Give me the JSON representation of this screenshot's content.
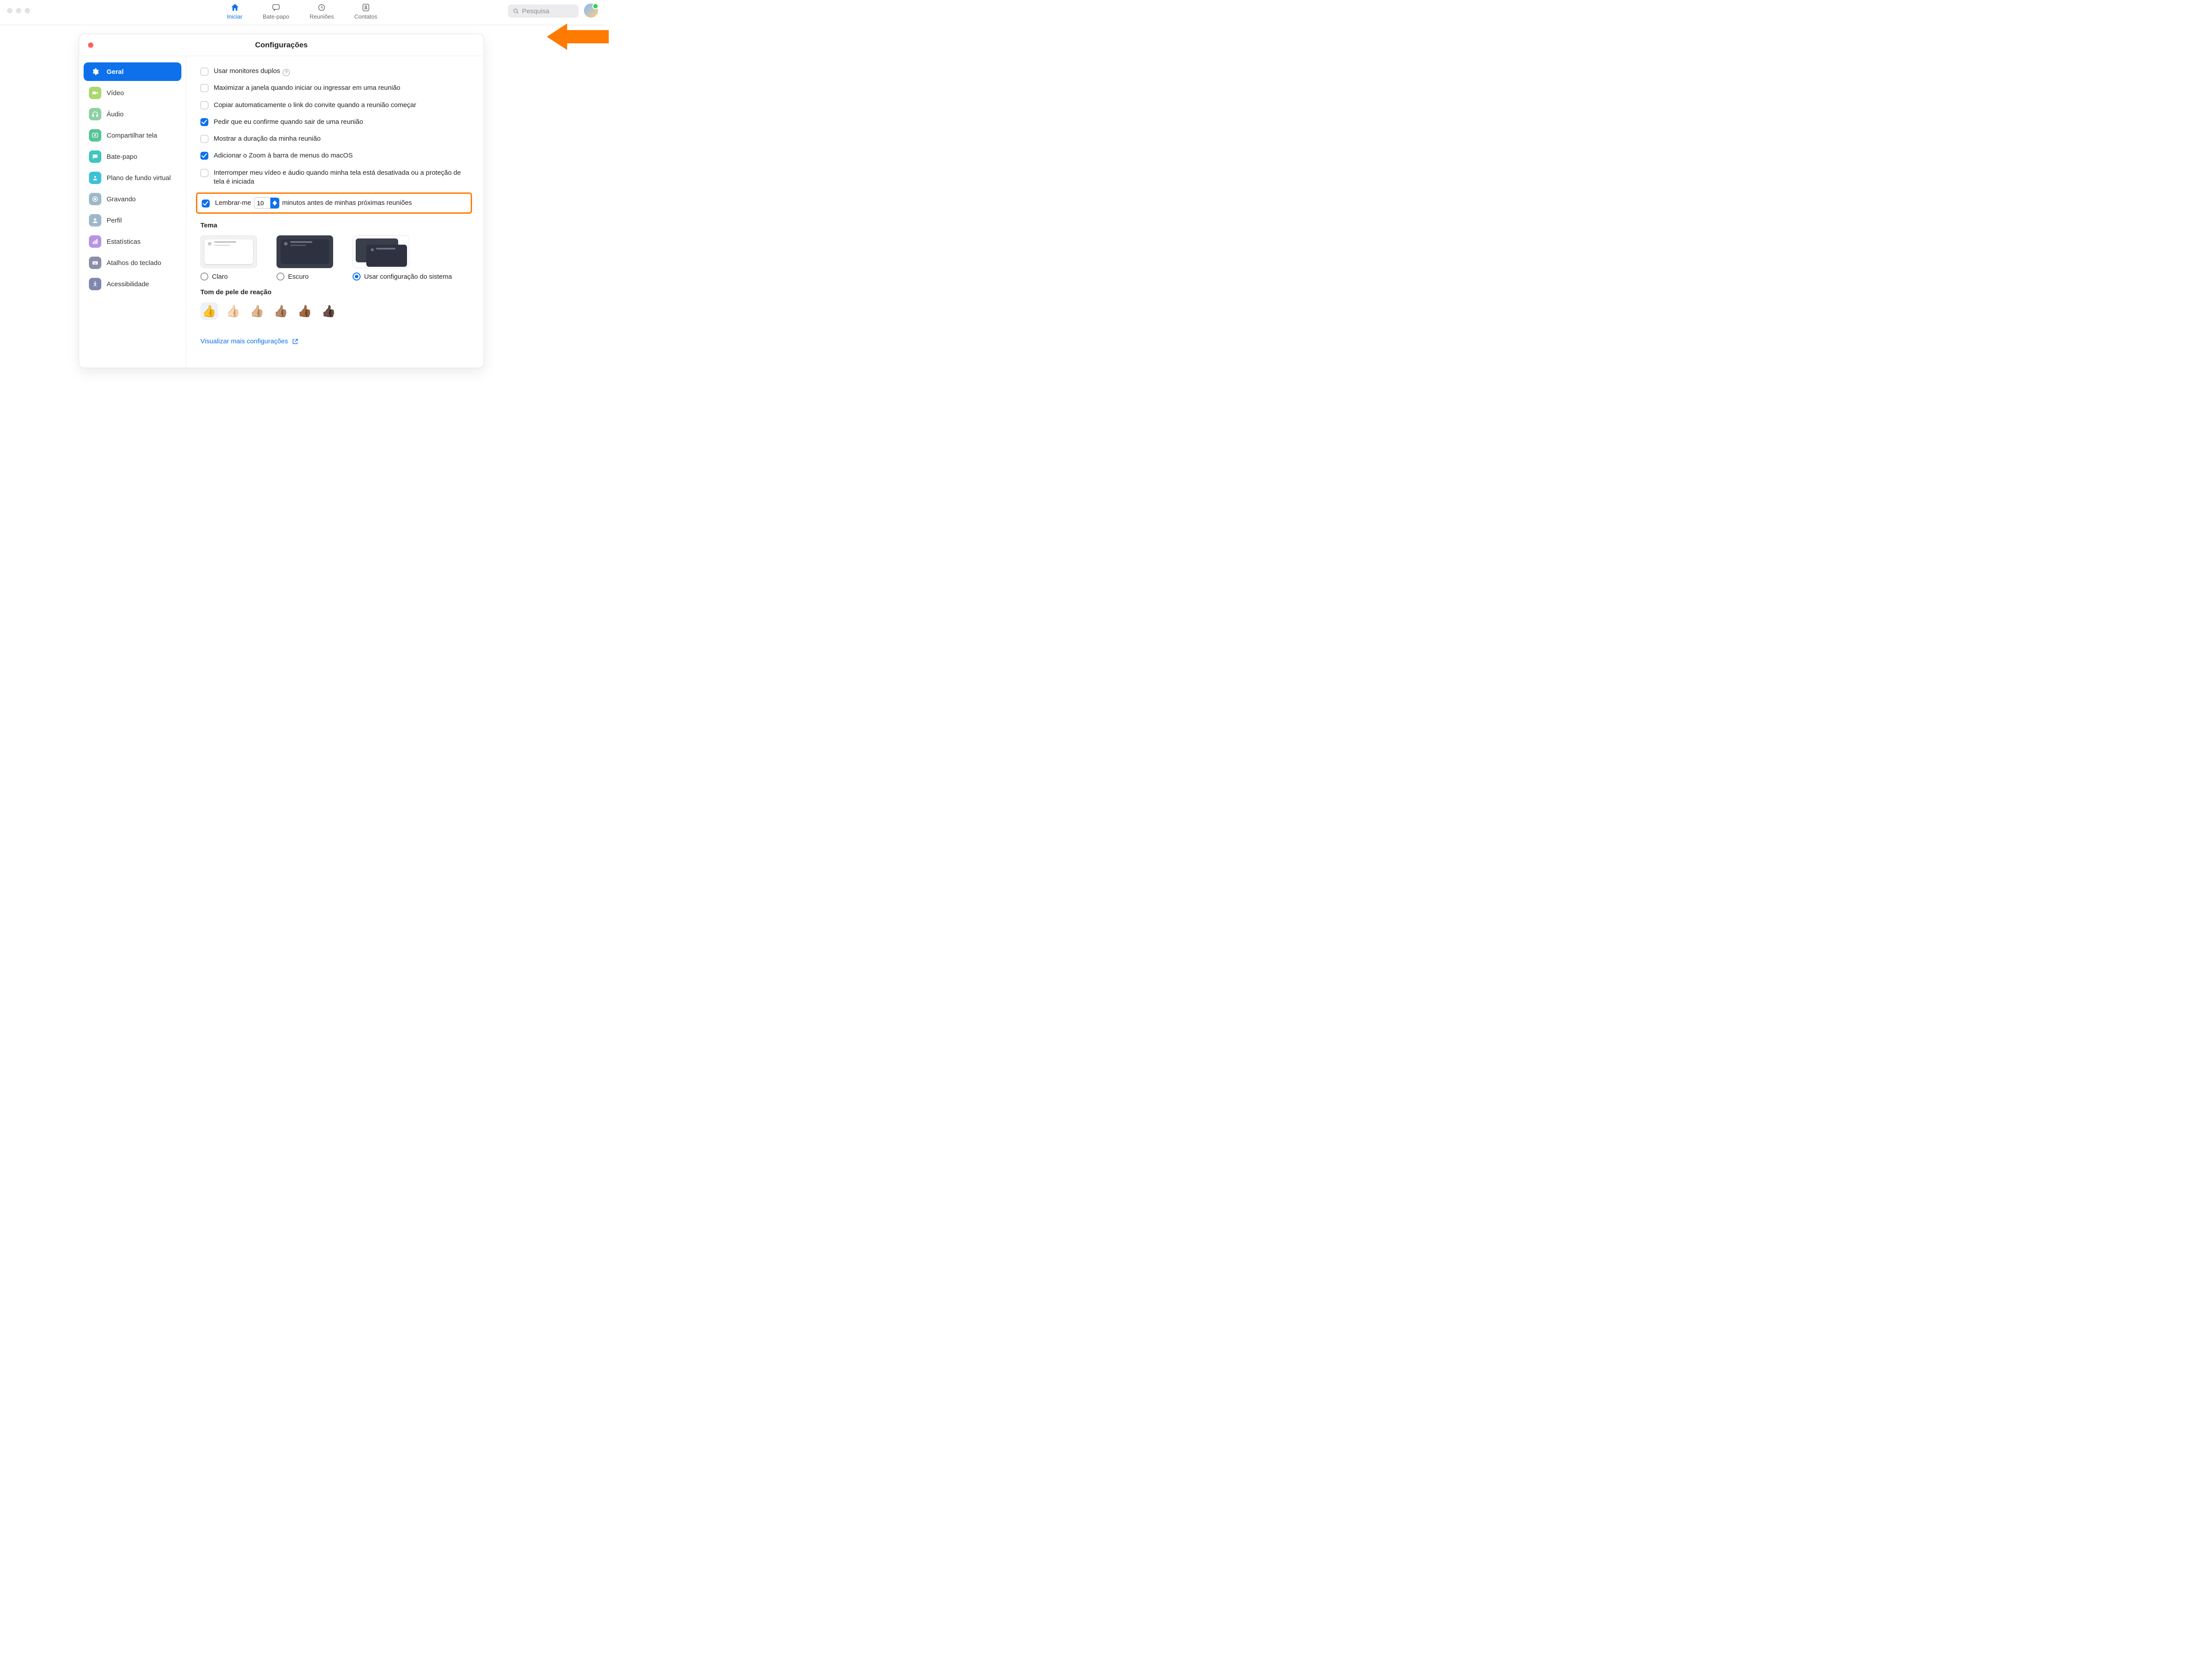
{
  "topnav": {
    "home": "Iniciar",
    "chat": "Bate-papo",
    "meetings": "Reuniões",
    "contacts": "Contatos"
  },
  "search_placeholder": "Pesquisa",
  "window_title": "Configurações",
  "sidebar": {
    "general": "Geral",
    "video": "Vídeo",
    "audio": "Áudio",
    "share": "Compartilhar tela",
    "chat": "Bate-papo",
    "vb": "Plano de fundo virtual",
    "recording": "Gravando",
    "profile": "Perfil",
    "stats": "Estatísticas",
    "shortcuts": "Atalhos do teclado",
    "a11y": "Acessibilidade"
  },
  "opts": {
    "dual": "Usar monitores duplos",
    "maximize": "Maximizar a janela quando iniciar ou ingressar em uma reunião",
    "copy": "Copiar automaticamente o link do convite quando a reunião começar",
    "confirm": "Pedir que eu confirme quando sair de uma reunião",
    "duration": "Mostrar a duração da minha reunião",
    "menubar": "Adicionar o Zoom à barra de menus do macOS",
    "interrupt": "Interromper meu vídeo e áudio quando minha tela está desativada ou a proteção de tela é iniciada",
    "remind_pre": "Lembrar-me",
    "remind_value": "10",
    "remind_post": "minutos antes de minhas próximas reuniões"
  },
  "theme": {
    "title": "Tema",
    "light": "Claro",
    "dark": "Escuro",
    "system": "Usar configuração do sistema"
  },
  "skin_title": "Tom de pele de reação",
  "skins": [
    "👍",
    "👍🏻",
    "👍🏼",
    "👍🏽",
    "👍🏾",
    "👍🏿"
  ],
  "more_link": "Visualizar mais configurações"
}
